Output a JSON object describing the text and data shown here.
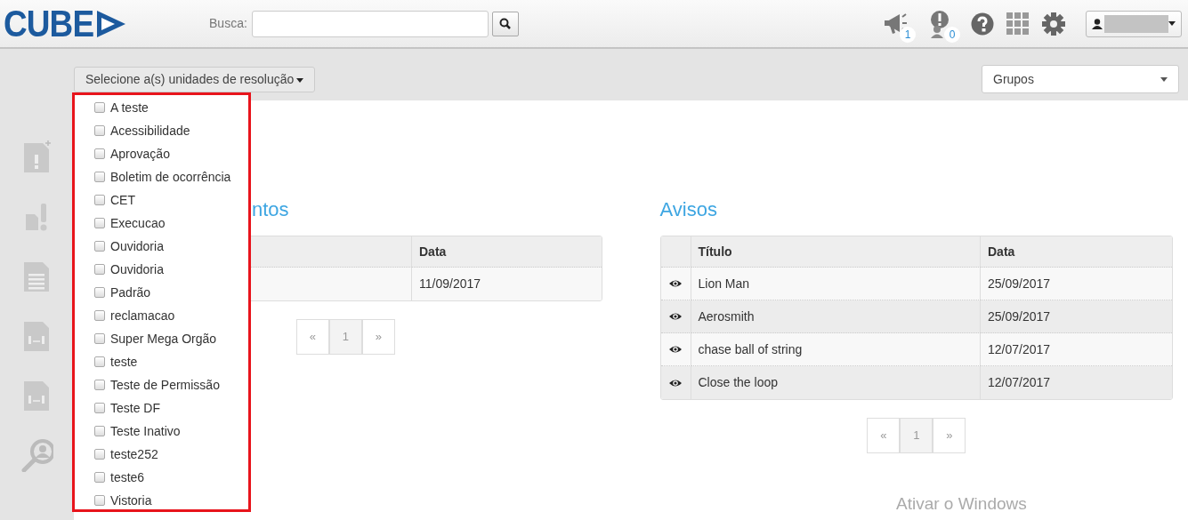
{
  "header": {
    "logo": "CUBE",
    "search_label": "Busca:",
    "notification_badges": [
      {
        "kind": "megaphone",
        "count": "1"
      },
      {
        "kind": "alert",
        "count": "0"
      }
    ]
  },
  "unit_selector": {
    "label": "Selecione a(s) unidades de resolução",
    "expanded": true,
    "options": [
      {
        "label": "A teste",
        "checked": false
      },
      {
        "label": "Acessibilidade",
        "checked": false
      },
      {
        "label": "Aprovação",
        "checked": false
      },
      {
        "label": "Boletim de ocorrência",
        "checked": false
      },
      {
        "label": "CET",
        "checked": false
      },
      {
        "label": "Execucao",
        "checked": false
      },
      {
        "label": "Ouvidoria",
        "checked": false
      },
      {
        "label": "Ouvidoria",
        "checked": false
      },
      {
        "label": "Padrão",
        "checked": false
      },
      {
        "label": "reclamacao",
        "checked": false
      },
      {
        "label": "Super Mega Orgão",
        "checked": false
      },
      {
        "label": "teste",
        "checked": false
      },
      {
        "label": "Teste de Permissão",
        "checked": false
      },
      {
        "label": "Teste DF",
        "checked": false
      },
      {
        "label": "Teste Inativo",
        "checked": false
      },
      {
        "label": "teste252",
        "checked": false
      },
      {
        "label": "teste6",
        "checked": false
      },
      {
        "label": "Vistoria",
        "checked": false
      }
    ]
  },
  "group_select": {
    "value": "Grupos"
  },
  "sections": [
    {
      "kind": "covered",
      "title": "ntos",
      "columns": [
        "Data"
      ],
      "rows": [
        {
          "cells": [
            "11/09/2017"
          ]
        }
      ],
      "pagination": {
        "prev": "«",
        "pages": [
          {
            "label": "1",
            "selected": true
          }
        ],
        "next": "»"
      }
    },
    {
      "kind": "viewable",
      "title": "Avisos",
      "columns": [
        "Título",
        "Data"
      ],
      "rows": [
        {
          "cells": [
            "Lion Man",
            "25/09/2017"
          ]
        },
        {
          "cells": [
            "Aerosmith",
            "25/09/2017"
          ]
        },
        {
          "cells": [
            "chase ball of string",
            "12/07/2017"
          ]
        },
        {
          "cells": [
            "Close the loop",
            "12/07/2017"
          ]
        }
      ],
      "pagination": {
        "prev": "«",
        "pages": [
          {
            "label": "1",
            "selected": true
          }
        ],
        "next": "»"
      }
    }
  ],
  "os_overlay": {
    "title": "Ativar o Windows"
  }
}
